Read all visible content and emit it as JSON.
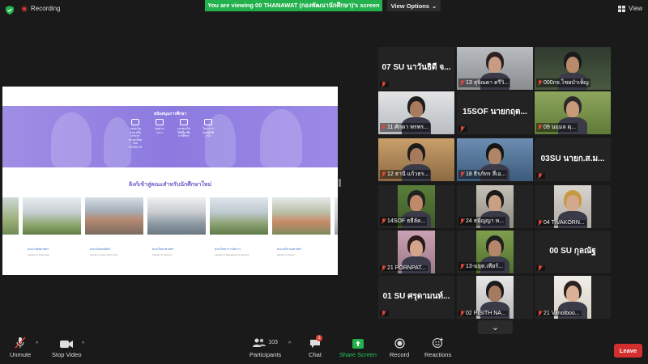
{
  "top": {
    "recording_label": "Recording",
    "viewing_banner": "You are viewing 00 THANAWAT (กองพัฒนานักศึกษา)'s screen",
    "view_options_label": "View Options",
    "view_label": "View"
  },
  "share": {
    "hero_title": "สนับสนุนการศึกษา",
    "hero_items": [
      "ของขวัญช่วยเหลือ บรรเทาความเดือดร้อน COVID-19",
      "ทุนส่วนกลาง",
      "กองทุนเงินให้กู้ยืมเพื่อการศึกษา",
      "โครงการทุนปฏิบัติงาน"
    ],
    "links_title": "ลิงก์เข้าสู่คณะสำหรับนักศึกษาใหม่",
    "faculties": [
      {
        "name": "คณะเภสัชศาสตร์",
        "sub": "Faculty of Pharmacy"
      },
      {
        "name": "คณะมัณฑนศิลป์",
        "sub": "Faculty of Decorative Arts"
      },
      {
        "name": "คณะวิทยาศาสตร์",
        "sub": "Faculty of Science"
      },
      {
        "name": "คณะวิทยาการจัดการ",
        "sub": "Faculty of Management Science"
      },
      {
        "name": "คณะดุริยางคศาสตร์",
        "sub": "Faculty of Music"
      },
      {
        "name": "คณะสถาปัตยกรรม",
        "sub": "Faculty of Architecture"
      }
    ]
  },
  "gallery": [
    {
      "name": "07 SU นาวันธิดี จ...",
      "type": "text"
    },
    {
      "name": "13 สุจิณดา ตรีวิ...",
      "type": "video"
    },
    {
      "name": "000กจ.ไชยบำเพ็ญ",
      "type": "video"
    },
    {
      "name": "11 ศักดา พรพร...",
      "type": "video"
    },
    {
      "name": "15SOF นายกฤต...",
      "type": "text"
    },
    {
      "name": "09 นฤมล ตุ...",
      "type": "video"
    },
    {
      "name": "12 ธานี แก้วธร...",
      "type": "video"
    },
    {
      "name": "18 ธีรภัทร สี่เอ...",
      "type": "video"
    },
    {
      "name": "03SU นายก.ส.ม...",
      "type": "text"
    },
    {
      "name": "14SOF ธธีลัด...",
      "type": "video"
    },
    {
      "name": "24 ธนัญญา ห...",
      "type": "video"
    },
    {
      "name": "04 TIVAKORN...",
      "type": "video"
    },
    {
      "name": "21 PORNPAT...",
      "type": "video"
    },
    {
      "name": "13-มยุต.เพียร์...",
      "type": "video"
    },
    {
      "name": "00 SU กุลณัฐ",
      "type": "text"
    },
    {
      "name": "01 SU ศรุดามนท์...",
      "type": "text"
    },
    {
      "name": "02 PISITH NA...",
      "type": "video"
    },
    {
      "name": "21 Vimolboo...",
      "type": "video"
    }
  ],
  "toolbar": {
    "unmute": "Unmute",
    "stop_video": "Stop Video",
    "participants": "Participants",
    "participants_count": "103",
    "chat": "Chat",
    "chat_badge": "1",
    "share_screen": "Share Screen",
    "record": "Record",
    "reactions": "Reactions",
    "leave": "Leave"
  },
  "colors": {
    "banner_green": "#23b14d",
    "hero_purple": "#8c7ae0",
    "leave_red": "#d32f2f",
    "highlight": "#c8e24b"
  }
}
